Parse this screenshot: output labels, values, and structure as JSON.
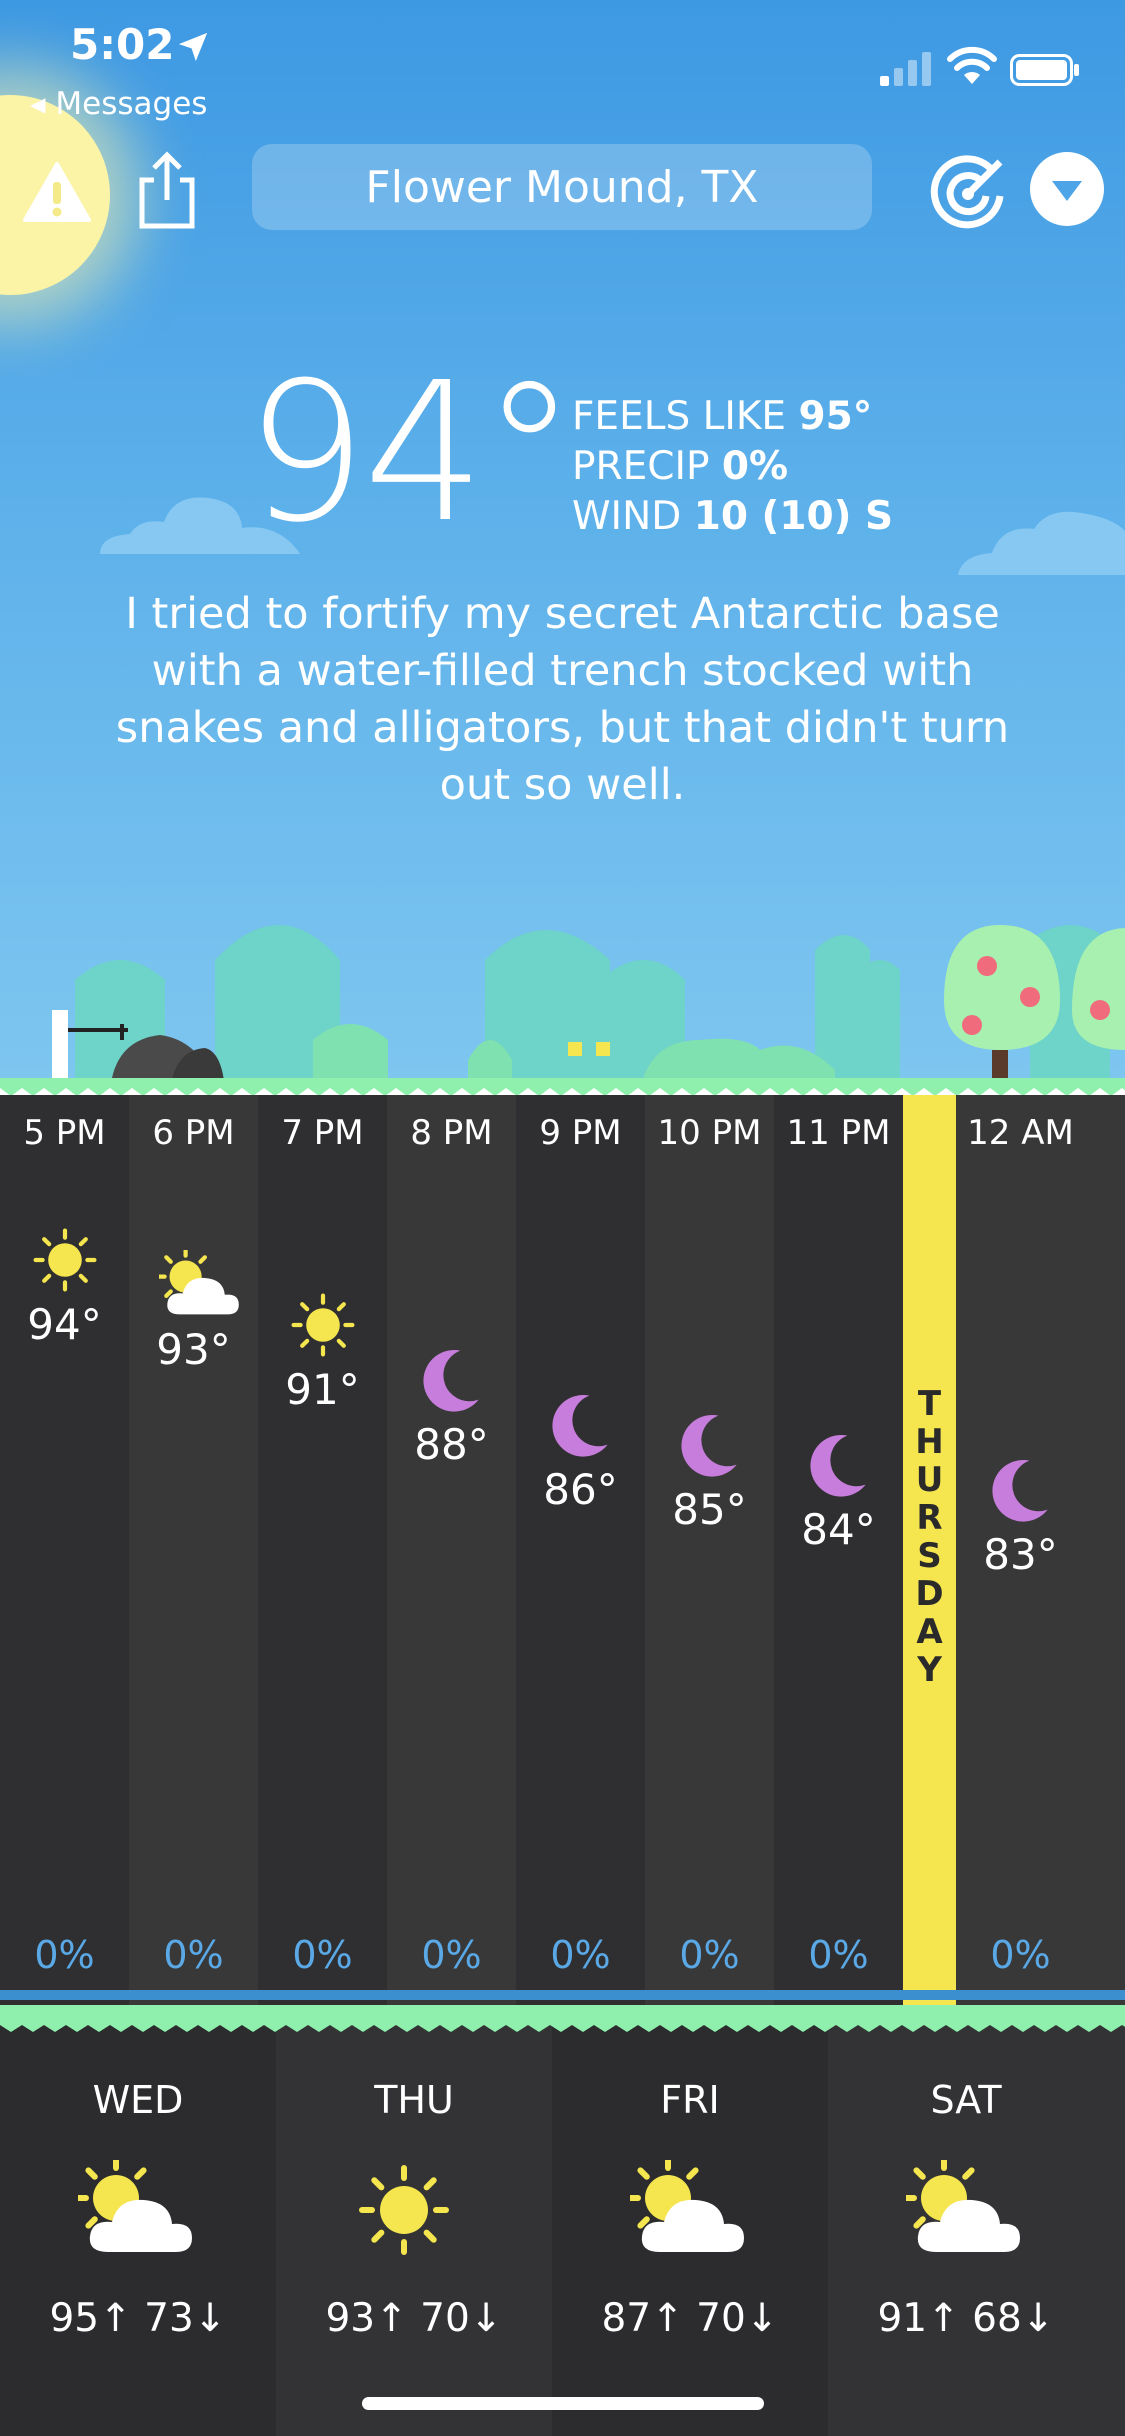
{
  "status_bar": {
    "time": "5:02",
    "back_label": "Messages"
  },
  "header": {
    "location": "Flower Mound, TX"
  },
  "current": {
    "temperature": "94°",
    "feels_like_label": "FEELS LIKE",
    "feels_like_value": "95°",
    "precip_label": "PRECIP",
    "precip_value": "0%",
    "wind_label": "WIND",
    "wind_value": "10 (10) S",
    "quote": "I tried to fortify my secret Antarctic base with a water-filled trench stocked with snakes and alligators, but that didn't turn out so well."
  },
  "hourly": [
    {
      "time": "5 PM",
      "icon": "sun-icon",
      "temp": "94°",
      "precip": "0%"
    },
    {
      "time": "6 PM",
      "icon": "partly-cloudy-icon",
      "temp": "93°",
      "precip": "0%"
    },
    {
      "time": "7 PM",
      "icon": "sun-icon",
      "temp": "91°",
      "precip": "0%"
    },
    {
      "time": "8 PM",
      "icon": "moon-icon",
      "temp": "88°",
      "precip": "0%"
    },
    {
      "time": "9 PM",
      "icon": "moon-icon",
      "temp": "86°",
      "precip": "0%"
    },
    {
      "time": "10 PM",
      "icon": "moon-icon",
      "temp": "85°",
      "precip": "0%"
    },
    {
      "time": "11 PM",
      "icon": "moon-icon",
      "temp": "84°",
      "precip": "0%"
    },
    {
      "time": "12 AM",
      "icon": "moon-icon",
      "temp": "83°",
      "precip": "0%"
    }
  ],
  "day_divider": "THURSDAY",
  "daily": [
    {
      "day": "WED",
      "icon": "partly-cloudy-icon",
      "temps": "95↑ 73↓"
    },
    {
      "day": "THU",
      "icon": "sun-icon",
      "temps": "93↑ 70↓"
    },
    {
      "day": "FRI",
      "icon": "partly-cloudy-icon",
      "temps": "87↑ 70↓"
    },
    {
      "day": "SAT",
      "icon": "partly-cloudy-icon",
      "temps": "91↑ 68↓"
    }
  ],
  "colors": {
    "sky": "#4da5e7",
    "sun": "#f5e54e",
    "moon": "#c77ddb",
    "grass": "#8ff0ad",
    "precip": "#5aa9e6"
  }
}
